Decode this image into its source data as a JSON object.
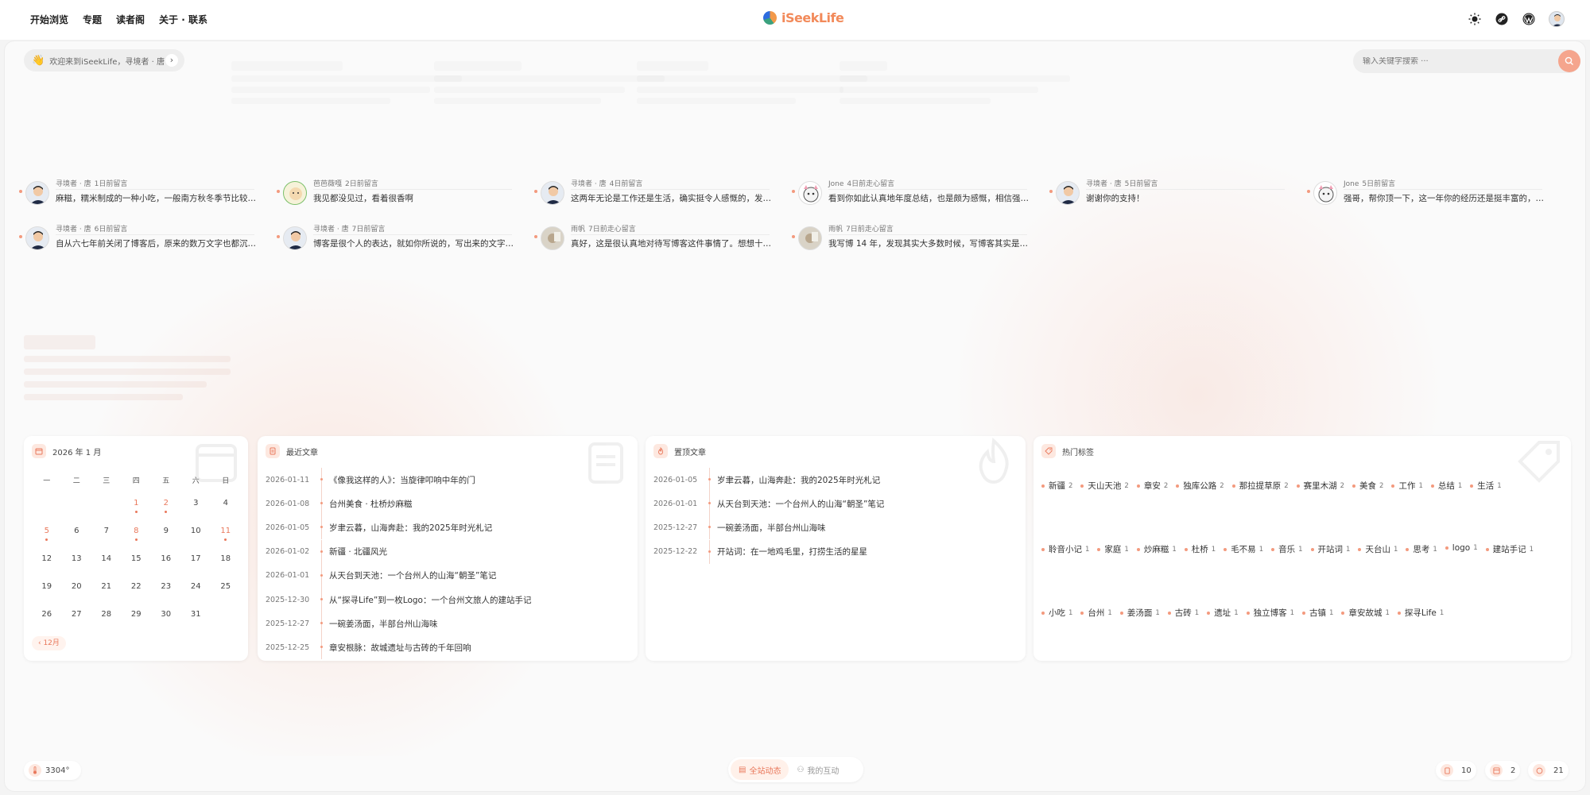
{
  "nav": {
    "items": [
      "开始浏览",
      "专题",
      "读者阁",
      "关于 · 联系"
    ],
    "logo_text": "iSeekLife"
  },
  "welcome": {
    "text": "欢迎来到iSeekLife，寻境者 · 唐"
  },
  "search": {
    "placeholder": "输入关键字搜索 ···"
  },
  "comments": [
    {
      "author": "寻境者 · 唐",
      "time": "1日前留言",
      "text": "麻糍，糯米制成的一种小吃，一般南方秋冬季节比较…"
    },
    {
      "author": "芭芭薇嘎",
      "time": "2日前留言",
      "text": "我见都没见过，看着很香啊"
    },
    {
      "author": "寻境者 · 唐",
      "time": "4日前留言",
      "text": "这两年无论是工作还是生活，确实挺令人感慨的，发…"
    },
    {
      "author": "Jone",
      "time": "4日前走心留言",
      "text": "看到你如此认真地年度总结，也是颇为感慨，相信强…"
    },
    {
      "author": "寻境者 · 唐",
      "time": "5日前留言",
      "text": "谢谢你的支持！"
    },
    {
      "author": "Jone",
      "time": "5日前留言",
      "text": "强哥，帮你顶一下，这一年你的经历还是挺丰富的，…"
    },
    {
      "author": "寻境者 · 唐",
      "time": "6日前留言",
      "text": "自从六七年前关闭了博客后，原来的数万文字也都沉…"
    },
    {
      "author": "寻境者 · 唐",
      "time": "7日前留言",
      "text": "博客是很个人的表达，就如你所说的，写出来的文字…"
    },
    {
      "author": "雨帆",
      "time": "7日前走心留言",
      "text": "真好，这是很认真地对待写博客这件事情了。想想十…"
    },
    {
      "author": "雨帆",
      "time": "7日前走心留言",
      "text": "我写博 14 年，发现其实大多数时候，写博客其实是…"
    }
  ],
  "calendar": {
    "title": "2026 年 1 月",
    "weekdays": [
      "一",
      "二",
      "三",
      "四",
      "五",
      "六",
      "日"
    ],
    "weeks": [
      [
        "",
        "",
        "",
        "1",
        "2",
        "3",
        "4"
      ],
      [
        "5",
        "6",
        "7",
        "8",
        "9",
        "10",
        "11"
      ],
      [
        "12",
        "13",
        "14",
        "15",
        "16",
        "17",
        "18"
      ],
      [
        "19",
        "20",
        "21",
        "22",
        "23",
        "24",
        "25"
      ],
      [
        "26",
        "27",
        "28",
        "29",
        "30",
        "31",
        ""
      ]
    ],
    "marked_days": [
      "1",
      "2",
      "5",
      "8",
      "11"
    ],
    "prev_label": "‹ 12月"
  },
  "recent": {
    "title": "最近文章",
    "items": [
      {
        "date": "2026-01-11",
        "title": "《像我这样的人》：当旋律叩响中年的门"
      },
      {
        "date": "2026-01-08",
        "title": "台州美食 · 杜桥炒麻糍"
      },
      {
        "date": "2026-01-05",
        "title": "岁聿云暮，山海奔赴：我的2025年时光札记"
      },
      {
        "date": "2026-01-02",
        "title": "新疆 · 北疆风光"
      },
      {
        "date": "2026-01-01",
        "title": "从天台到天池：一个台州人的山海“朝圣”笔记"
      },
      {
        "date": "2025-12-30",
        "title": "从“探寻Life”到一枚Logo：一个台州文旅人的建站手记"
      },
      {
        "date": "2025-12-27",
        "title": "一碗姜汤面，半部台州山海味"
      },
      {
        "date": "2025-12-25",
        "title": "章安根脉：故城遗址与古砖的千年回响"
      }
    ]
  },
  "pinned": {
    "title": "置顶文章",
    "items": [
      {
        "date": "2026-01-05",
        "title": "岁聿云暮，山海奔赴：我的2025年时光札记"
      },
      {
        "date": "2026-01-01",
        "title": "从天台到天池：一个台州人的山海“朝圣”笔记"
      },
      {
        "date": "2025-12-27",
        "title": "一碗姜汤面，半部台州山海味"
      },
      {
        "date": "2025-12-22",
        "title": "开站词：在一地鸡毛里，打捞生活的星星"
      }
    ]
  },
  "tags": {
    "title": "热门标签",
    "rows": [
      [
        {
          "name": "新疆",
          "count": "2"
        },
        {
          "name": "天山天池",
          "count": "2"
        },
        {
          "name": "章安",
          "count": "2"
        },
        {
          "name": "独库公路",
          "count": "2"
        },
        {
          "name": "那拉提草原",
          "count": "2"
        },
        {
          "name": "赛里木湖",
          "count": "2"
        },
        {
          "name": "美食",
          "count": "2"
        },
        {
          "name": "工作",
          "count": "1"
        },
        {
          "name": "总结",
          "count": "1"
        },
        {
          "name": "生活",
          "count": "1"
        }
      ],
      [
        {
          "name": "聆音小记",
          "count": "1"
        },
        {
          "name": "家庭",
          "count": "1"
        },
        {
          "name": "炒麻糍",
          "count": "1"
        },
        {
          "name": "杜桥",
          "count": "1"
        },
        {
          "name": "毛不易",
          "count": "1"
        },
        {
          "name": "音乐",
          "count": "1"
        },
        {
          "name": "开站词",
          "count": "1"
        },
        {
          "name": "天台山",
          "count": "1"
        },
        {
          "name": "思考",
          "count": "1"
        },
        {
          "name": "logo",
          "count": "1"
        },
        {
          "name": "建站手记",
          "count": "1"
        }
      ],
      [
        {
          "name": "小吃",
          "count": "1"
        },
        {
          "name": "台州",
          "count": "1"
        },
        {
          "name": "姜汤面",
          "count": "1"
        },
        {
          "name": "古砖",
          "count": "1"
        },
        {
          "name": "遗址",
          "count": "1"
        },
        {
          "name": "独立博客",
          "count": "1"
        },
        {
          "name": "古镇",
          "count": "1"
        },
        {
          "name": "章安故城",
          "count": "1"
        },
        {
          "name": "探寻Life",
          "count": "1"
        }
      ]
    ]
  },
  "bottom": {
    "visits": "3304°",
    "seg_all": "全站动态",
    "seg_mine": "我的互动",
    "stat_articles": "10",
    "stat_pages": "2",
    "stat_comments": "21"
  },
  "colors": {
    "accent": "#e9785b",
    "accent_light": "#fde8e0"
  }
}
